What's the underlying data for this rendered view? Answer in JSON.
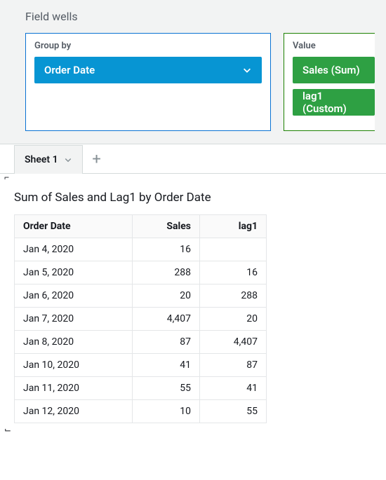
{
  "fieldwells": {
    "title": "Field wells",
    "groupby": {
      "label": "Group by",
      "pills": [
        "Order Date"
      ]
    },
    "value": {
      "label": "Value",
      "pills": [
        "Sales (Sum)",
        "lag1 (Custom)"
      ]
    }
  },
  "sheets": {
    "active": "Sheet 1",
    "add_glyph": "+"
  },
  "viz": {
    "title": "Sum of Sales and Lag1 by Order Date",
    "columns": [
      "Order Date",
      "Sales",
      "lag1"
    ]
  },
  "chart_data": {
    "type": "table",
    "columns": [
      "Order Date",
      "Sales",
      "lag1"
    ],
    "rows": [
      {
        "Order Date": "Jan 4, 2020",
        "Sales": "16",
        "lag1": ""
      },
      {
        "Order Date": "Jan 5, 2020",
        "Sales": "288",
        "lag1": "16"
      },
      {
        "Order Date": "Jan 6, 2020",
        "Sales": "20",
        "lag1": "288"
      },
      {
        "Order Date": "Jan 7, 2020",
        "Sales": "4,407",
        "lag1": "20"
      },
      {
        "Order Date": "Jan 8, 2020",
        "Sales": "87",
        "lag1": "4,407"
      },
      {
        "Order Date": "Jan 10, 2020",
        "Sales": "41",
        "lag1": "87"
      },
      {
        "Order Date": "Jan 11, 2020",
        "Sales": "55",
        "lag1": "41"
      },
      {
        "Order Date": "Jan 12, 2020",
        "Sales": "10",
        "lag1": "55"
      }
    ]
  },
  "brackets": {
    "tl": "⌐",
    "bl": "⌙"
  },
  "colors": {
    "blue_pill": "#0795d3",
    "green_pill": "#2ea043",
    "panel_bg": "#f2f3f3",
    "border": "#d5dbdb"
  }
}
